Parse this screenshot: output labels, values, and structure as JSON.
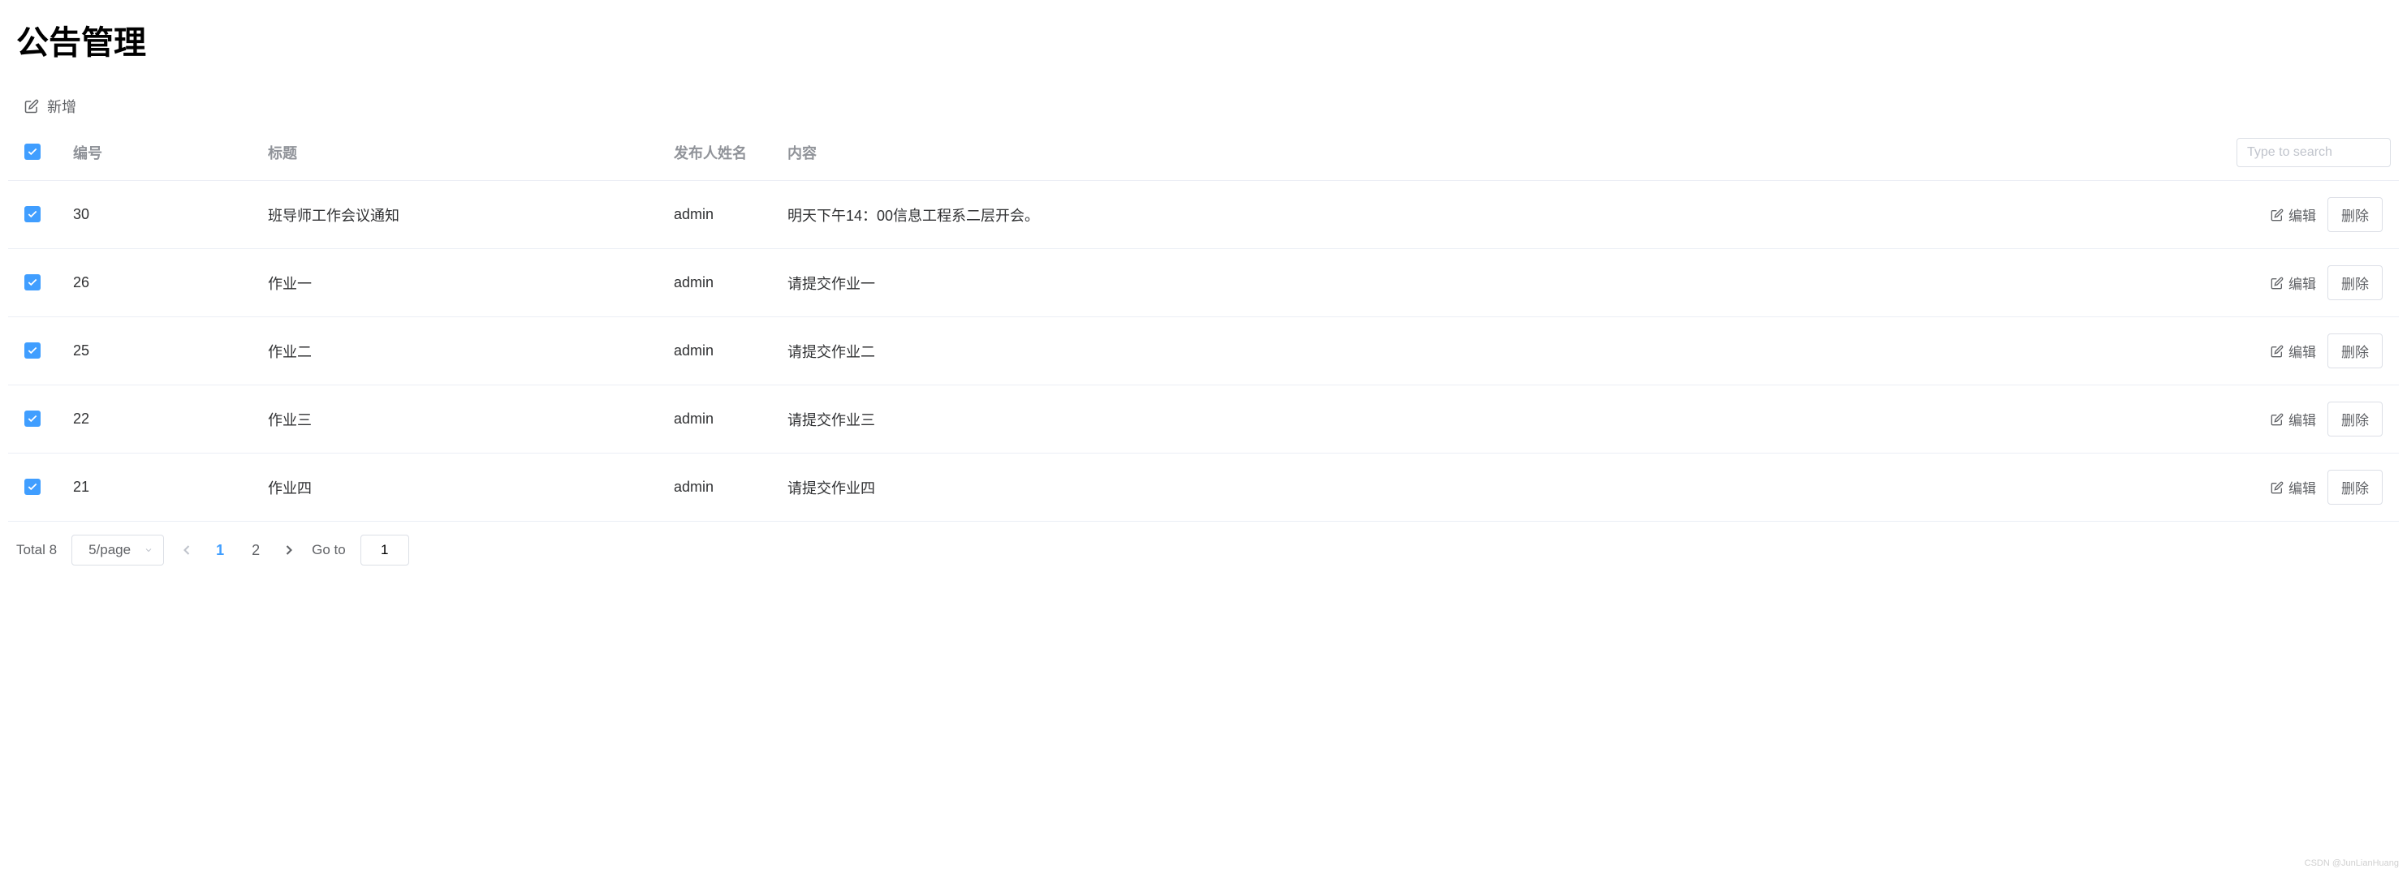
{
  "page_title": "公告管理",
  "toolbar": {
    "add_label": "新增"
  },
  "search": {
    "placeholder": "Type to search"
  },
  "table": {
    "headers": {
      "id": "编号",
      "title": "标题",
      "author": "发布人姓名",
      "content": "内容"
    },
    "rows": [
      {
        "id": "30",
        "title": "班导师工作会议通知",
        "author": "admin",
        "content": "明天下午14：00信息工程系二层开会。"
      },
      {
        "id": "26",
        "title": "作业一",
        "author": "admin",
        "content": "请提交作业一"
      },
      {
        "id": "25",
        "title": "作业二",
        "author": "admin",
        "content": "请提交作业二"
      },
      {
        "id": "22",
        "title": "作业三",
        "author": "admin",
        "content": "请提交作业三"
      },
      {
        "id": "21",
        "title": "作业四",
        "author": "admin",
        "content": "请提交作业四"
      }
    ]
  },
  "actions": {
    "edit": "编辑",
    "delete": "删除"
  },
  "pagination": {
    "total_label": "Total 8",
    "page_size": "5/page",
    "pages": [
      "1",
      "2"
    ],
    "active_page": "1",
    "goto_label": "Go to",
    "goto_value": "1"
  },
  "watermark": "CSDN @JunLianHuang"
}
